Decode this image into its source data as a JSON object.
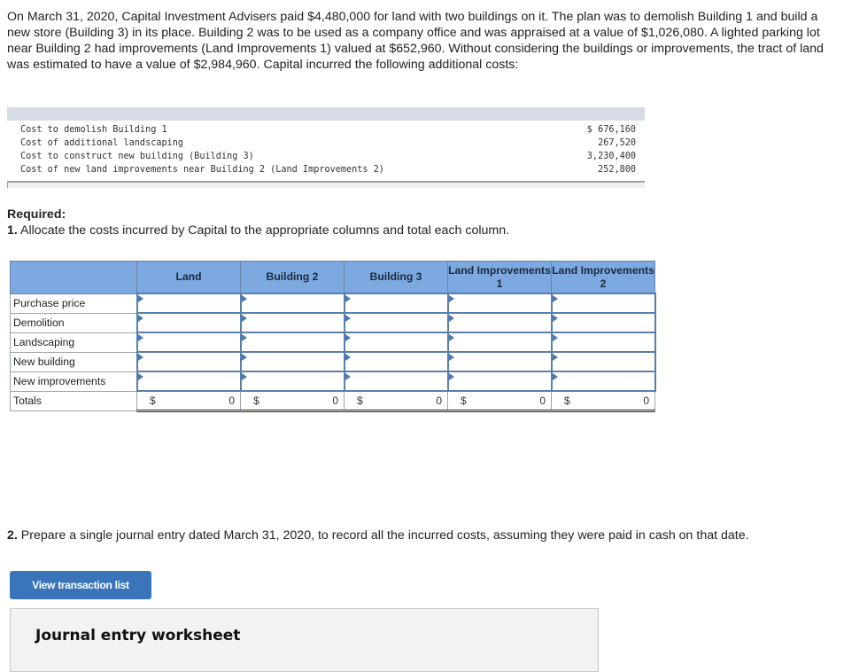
{
  "intro_text": "On March 31, 2020, Capital Investment Advisers paid $4,480,000 for land with two buildings on it. The plan was to demolish Building 1 and build a new store (Building 3) in its place. Building 2 was to be used as a company office and was appraised at a value of $1,026,080. A lighted parking lot near Building 2 had improvements (Land Improvements 1) valued at $652,960. Without considering the buildings or improvements, the tract of land was estimated to have a value of $2,984,960. Capital incurred the following additional costs:",
  "costs": [
    {
      "label": "Cost to demolish Building 1",
      "amount": "$ 676,160"
    },
    {
      "label": "Cost of additional landscaping",
      "amount": "267,520"
    },
    {
      "label": "Cost to construct new building (Building 3)",
      "amount": "3,230,400"
    },
    {
      "label": "Cost of new land improvements near Building 2 (Land Improvements 2)",
      "amount": "252,800"
    }
  ],
  "required": {
    "heading": "Required:",
    "part1_number": "1.",
    "part1_text": " Allocate the costs incurred by Capital to the appropriate columns and total each column.",
    "part2_number": "2.",
    "part2_text": " Prepare a single journal entry dated March 31, 2020, to record all the incurred costs, assuming they were paid in cash on that date."
  },
  "allocation_table": {
    "columns": [
      "Land",
      "Building 2",
      "Building 3",
      "Land Improvements 1",
      "Land Improvements 2"
    ],
    "rows": [
      "Purchase price",
      "Demolition",
      "Landscaping",
      "New building",
      "New improvements"
    ],
    "totals_label": "Totals",
    "currency_symbol": "$",
    "totals": [
      "0",
      "0",
      "0",
      "0",
      "0"
    ]
  },
  "buttons": {
    "view_transaction_list": "View transaction list"
  },
  "worksheet": {
    "title": "Journal entry worksheet"
  }
}
